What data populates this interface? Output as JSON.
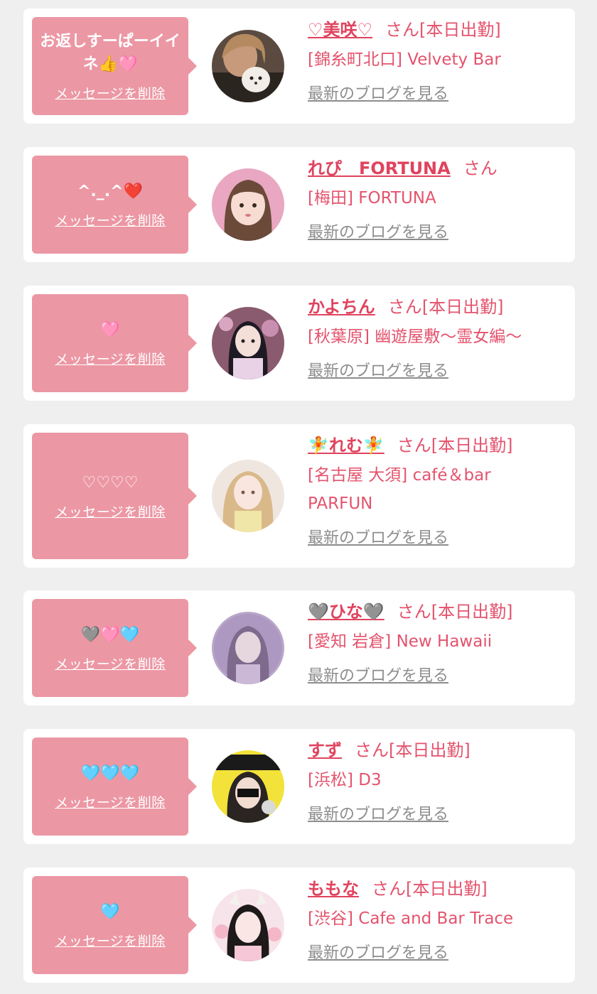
{
  "delete_label": "メッセージを削除",
  "blog_label": "最新のブログを見る",
  "suffix_san": "さん",
  "suffix_working": "[本日出勤]",
  "messages": [
    {
      "message": "お返しすーぱーイイネ👍🩷",
      "name": "♡美咲♡",
      "working": true,
      "shop": "[錦糸町北口] Velvety Bar"
    },
    {
      "message": "^._.^❤️",
      "name": "れぴ　FORTUNA",
      "working": false,
      "shop": "[梅田] FORTUNA"
    },
    {
      "message": "🩷",
      "name": "かよちん",
      "working": true,
      "shop": "[秋葉原] 幽遊屋敷〜霊女編〜"
    },
    {
      "message": "♡♡♡♡",
      "name": "🧚れむ🧚",
      "working": true,
      "shop": "[名古屋 大須] café＆bar PARFUN"
    },
    {
      "message": "🩶🩷🩵",
      "name": "🩶ひな🩶",
      "working": true,
      "shop": "[愛知 岩倉] New Hawaii"
    },
    {
      "message": "🩵🩵🩵",
      "name": "すず",
      "working": true,
      "shop": "[浜松] D3"
    },
    {
      "message": "🩵",
      "name": "ももな",
      "working": true,
      "shop": "[渋谷] Cafe and Bar Trace"
    }
  ],
  "colors": {
    "page_bg": "#efefef",
    "bubble": "#ec97a4",
    "name": "#e0435e",
    "text": "#e4536d",
    "blog_link": "#8d8d8d"
  }
}
